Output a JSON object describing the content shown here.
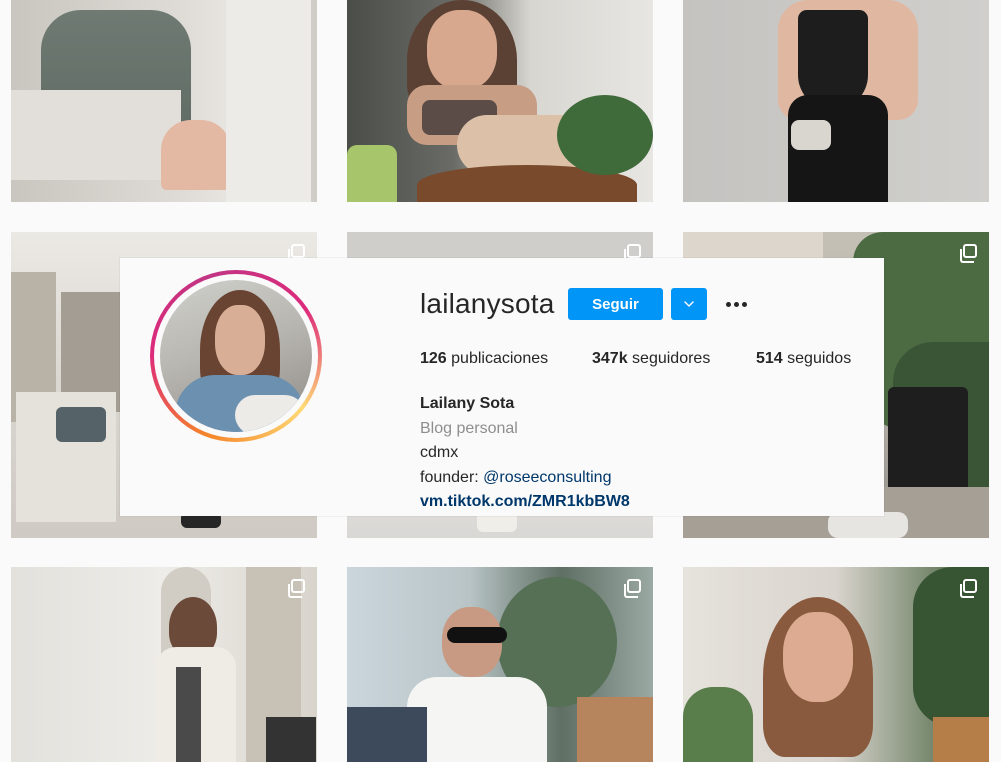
{
  "profile": {
    "username": "lailanysota",
    "follow_label": "Seguir",
    "stats": {
      "posts_count": "126",
      "posts_label": "publicaciones",
      "followers_count": "347k",
      "followers_label": "seguidores",
      "following_count": "514",
      "following_label": "seguidos"
    },
    "bio": {
      "name": "Lailany Sota",
      "category": "Blog personal",
      "location": "cdmx",
      "founder_prefix": "founder: ",
      "founder_mention": "@roseeconsulting",
      "link": "vm.tiktok.com/ZMR1kbBW8"
    }
  },
  "icons": {
    "dropdown": "chevron-down-icon",
    "more": "more-options-icon",
    "multi_post": "multiple-posts-icon"
  },
  "colors": {
    "accent": "#0095f6",
    "text": "#262626",
    "secondary_text": "#8e8e8e",
    "link": "#00376b",
    "background": "#fafafa"
  },
  "posts": [
    {
      "row": 1,
      "col": 1,
      "multi": false
    },
    {
      "row": 1,
      "col": 2,
      "multi": false
    },
    {
      "row": 1,
      "col": 3,
      "multi": false
    },
    {
      "row": 2,
      "col": 1,
      "multi": true
    },
    {
      "row": 2,
      "col": 2,
      "multi": true
    },
    {
      "row": 2,
      "col": 3,
      "multi": true
    },
    {
      "row": 3,
      "col": 1,
      "multi": true
    },
    {
      "row": 3,
      "col": 2,
      "multi": true
    },
    {
      "row": 3,
      "col": 3,
      "multi": true
    }
  ]
}
